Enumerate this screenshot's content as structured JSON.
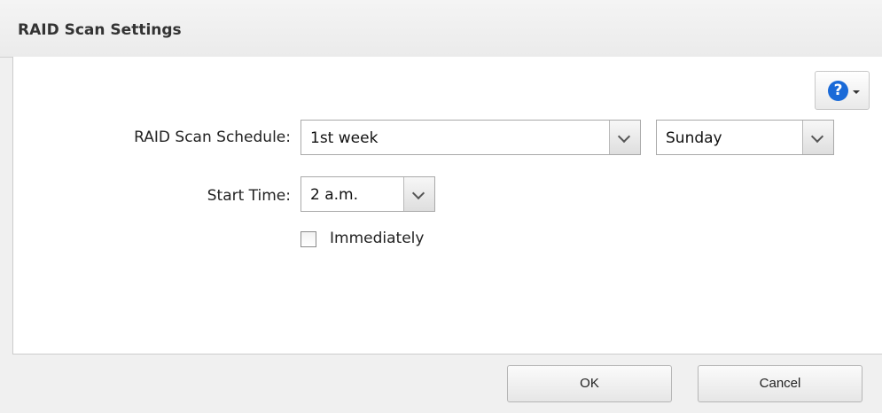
{
  "dialog": {
    "title": "RAID Scan Settings"
  },
  "help": {
    "icon": "help-icon",
    "glyph": "?"
  },
  "form": {
    "schedule_label": "RAID Scan Schedule:",
    "schedule_week_value": "1st week",
    "schedule_day_value": "Sunday",
    "start_time_label": "Start Time:",
    "start_time_value": "2 a.m.",
    "immediately_label": "Immediately",
    "immediately_checked": false
  },
  "footer": {
    "ok_label": "OK",
    "cancel_label": "Cancel"
  },
  "colors": {
    "help_icon": "#1a6ad8",
    "dialog_bg": "#f0f0f0",
    "panel_bg": "#ffffff"
  }
}
